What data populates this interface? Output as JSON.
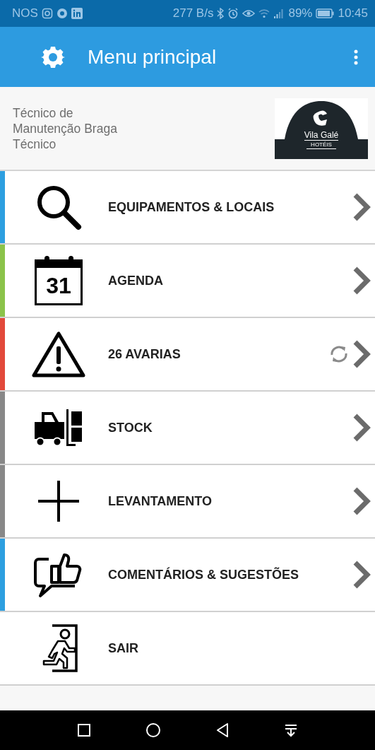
{
  "status_bar": {
    "carrier": "NOS",
    "speed": "277 B/s",
    "battery": "89%",
    "time": "10:45"
  },
  "app_bar": {
    "title": "Menu principal"
  },
  "profile": {
    "lines": [
      "Técnico de",
      "Manutenção Braga",
      "Técnico"
    ],
    "logo": {
      "name": "Vila Galé",
      "tagline": "HOTÉIS"
    }
  },
  "menu": [
    {
      "kind": "search",
      "label": "EQUIPAMENTOS & LOCAIS",
      "color": "#2d9fe0",
      "chevron": true,
      "sync": false
    },
    {
      "kind": "calendar",
      "label": "AGENDA",
      "day": "31",
      "color": "#8bc34a",
      "chevron": true,
      "sync": false
    },
    {
      "kind": "warning",
      "label": "26 AVARIAS",
      "color": "#e2493b",
      "chevron": true,
      "sync": true
    },
    {
      "kind": "stock",
      "label": "STOCK",
      "color": "#888888",
      "chevron": true,
      "sync": false
    },
    {
      "kind": "plus",
      "label": "LEVANTAMENTO",
      "color": "#888888",
      "chevron": true,
      "sync": false
    },
    {
      "kind": "feedback",
      "label": "COMENTÁRIOS & SUGESTÕES",
      "color": "#2d9fe0",
      "chevron": true,
      "sync": false
    },
    {
      "kind": "exit",
      "label": "SAIR",
      "chevron": false,
      "sync": false
    }
  ]
}
